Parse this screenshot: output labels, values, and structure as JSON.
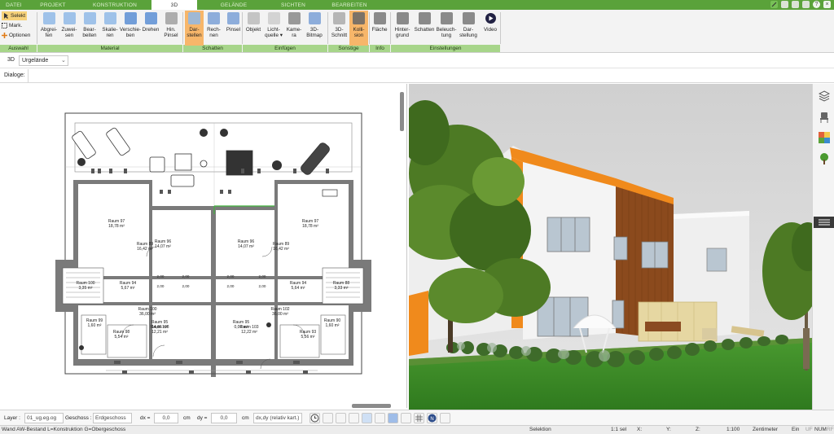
{
  "tabs": [
    "DATEI",
    "PROJEKT",
    "KONSTRUKTION",
    "3D",
    "GELÄNDE",
    "SICHTEN",
    "BEARBEITEN"
  ],
  "active_tab": "3D",
  "auswahl": {
    "selekt": "Selekt",
    "mark": "Mark.",
    "optionen": "Optionen",
    "group": "Auswahl"
  },
  "material_buttons": [
    {
      "l1": "Abgrei-",
      "l2": "fen"
    },
    {
      "l1": "Zuwei-",
      "l2": "sen"
    },
    {
      "l1": "Bear-",
      "l2": "beiten"
    },
    {
      "l1": "Skalie-",
      "l2": "ren"
    },
    {
      "l1": "Verschie-",
      "l2": "ben"
    },
    {
      "l1": "Drehen",
      "l2": ""
    },
    {
      "l1": "Hin.",
      "l2": "Pinsel"
    }
  ],
  "schatten_buttons": [
    {
      "l1": "Dar-",
      "l2": "stellen"
    },
    {
      "l1": "Rech-",
      "l2": "nen"
    },
    {
      "l1": "Pinsel",
      "l2": ""
    }
  ],
  "einfuegen_buttons": [
    {
      "l1": "Objekt",
      "l2": ""
    },
    {
      "l1": "Licht-",
      "l2": "quelle ▾"
    },
    {
      "l1": "Kame-",
      "l2": "ra"
    },
    {
      "l1": "3D-",
      "l2": "Bitmap"
    }
  ],
  "sonstige_buttons": [
    {
      "l1": "3D-",
      "l2": "Schnitt"
    },
    {
      "l1": "Kolli-",
      "l2": "sion"
    }
  ],
  "info_buttons": [
    {
      "l1": "Fläche",
      "l2": ""
    }
  ],
  "einstellungen_buttons": [
    {
      "l1": "Hinter-",
      "l2": "grund"
    },
    {
      "l1": "Schatten",
      "l2": ""
    },
    {
      "l1": "Beleuch-",
      "l2": "tung"
    },
    {
      "l1": "Dar-",
      "l2": "stellung"
    },
    {
      "l1": "Video",
      "l2": ""
    }
  ],
  "groups": {
    "auswahl": "Auswahl",
    "material": "Material",
    "schatten": "Schatten",
    "einfuegen": "Einfügen",
    "sonstige": "Sonstige",
    "info": "Info",
    "einstellungen": "Einstellungen"
  },
  "selector": {
    "mode": "3D",
    "value": "Urgelände"
  },
  "dialoge_label": "Dialoge:",
  "rooms_left": [
    {
      "name": "Raum 97",
      "area": "18,78 m²"
    },
    {
      "name": "Raum 96",
      "area": "14,07 m²"
    },
    {
      "name": "Raum 89",
      "area": "16,42 m²"
    },
    {
      "name": "Raum 94",
      "area": "5,67 m²"
    },
    {
      "name": "Raum 95",
      "area": "14,66 m²"
    },
    {
      "name": "Raum 108",
      "area": "12,21 m²"
    },
    {
      "name": "Raum 100",
      "area": "36,00 m²"
    },
    {
      "name": "Raum 99",
      "area": "1,60 m²"
    },
    {
      "name": "Raum 98",
      "area": "5,54 m²"
    },
    {
      "name": "Raum 100",
      "area": "3,35 m²"
    }
  ],
  "rooms_right": [
    {
      "name": "Raum 97",
      "area": "18,78 m²"
    },
    {
      "name": "Raum 96",
      "area": "14,07 m²"
    },
    {
      "name": "Raum 89",
      "area": "16,42 m²"
    },
    {
      "name": "Raum 94",
      "area": "5,64 m²"
    },
    {
      "name": "Raum 95",
      "area": "0,00 m²"
    },
    {
      "name": "Raum 103",
      "area": "12,22 m²"
    },
    {
      "name": "Raum 102",
      "area": "36,00 m²"
    },
    {
      "name": "Raum 90",
      "area": "1,60 m²"
    },
    {
      "name": "Raum 93",
      "area": "5,56 m²"
    },
    {
      "name": "Raum 88",
      "area": "3,33 m²"
    }
  ],
  "dim_labels": [
    "2,00",
    "2,00",
    "2,00",
    "2,00",
    "2,00",
    "2,00",
    "2,00",
    "2,00"
  ],
  "coordbar": {
    "layer_label": "Layer :",
    "layer_value": "01_ug.eg.og",
    "geschoss_label": "Geschoss :",
    "geschoss_value": "Erdgeschoss",
    "dx_label": "dx =",
    "dx_value": "0,0",
    "dy_label": "dy =",
    "dy_value": "0,0",
    "unit1": "cm",
    "unit2": "cm",
    "mode_value": "dx,dy (relativ kart.)"
  },
  "statusbar": {
    "hint": "Wand AW-Bestand L=Konstruktion G=Obergeschoss",
    "selektion": "Selektion",
    "sel_count": "1:1 sel",
    "x_label": "X:",
    "y_label": "Y:",
    "z_label": "Z:",
    "scale": "1:100",
    "unit": "Zentimeter",
    "ein": "Ein",
    "uf": "UF",
    "num": "NUM",
    "rf": "RF"
  },
  "colors": {
    "tabbar": "#5aa23a",
    "group_bar": "#a7d58a",
    "highlight": "#f7b66a",
    "sky": "#d6d6d6",
    "grass": "#3f8f2a",
    "house_white": "#f3f3f3",
    "house_orange": "#f08a1c",
    "wood": "#8b4a1d"
  }
}
